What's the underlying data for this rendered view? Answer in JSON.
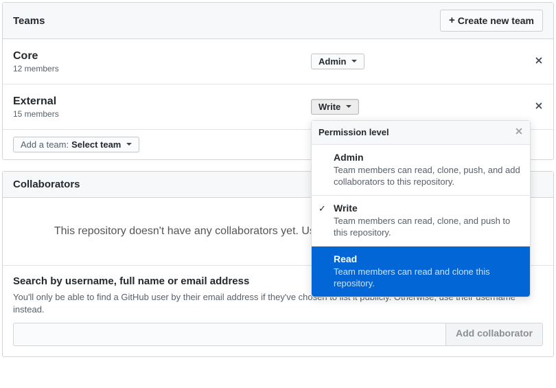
{
  "teams_panel": {
    "title": "Teams",
    "create_button": "Create new team",
    "rows": [
      {
        "name": "Core",
        "members": "12 members",
        "permission": "Admin"
      },
      {
        "name": "External",
        "members": "15 members",
        "permission": "Write"
      }
    ],
    "add_team": {
      "prefix": "Add a team:",
      "select": "Select team"
    }
  },
  "collaborators_panel": {
    "title": "Collaborators",
    "empty": "This repository doesn't have any collaborators yet. Use the form below to add a collaborator.",
    "search_heading": "Search by username, full name or email address",
    "search_help": "You'll only be able to find a GitHub user by their email address if they've chosen to list it publicly. Otherwise, use their username instead.",
    "add_button": "Add collaborator"
  },
  "dropdown": {
    "header": "Permission level",
    "items": [
      {
        "title": "Admin",
        "desc": "Team members can read, clone, push, and add collaborators to this repository.",
        "selected": false,
        "highlight": false
      },
      {
        "title": "Write",
        "desc": "Team members can read, clone, and push to this repository.",
        "selected": true,
        "highlight": false
      },
      {
        "title": "Read",
        "desc": "Team members can read and clone this repository.",
        "selected": false,
        "highlight": true
      }
    ]
  }
}
